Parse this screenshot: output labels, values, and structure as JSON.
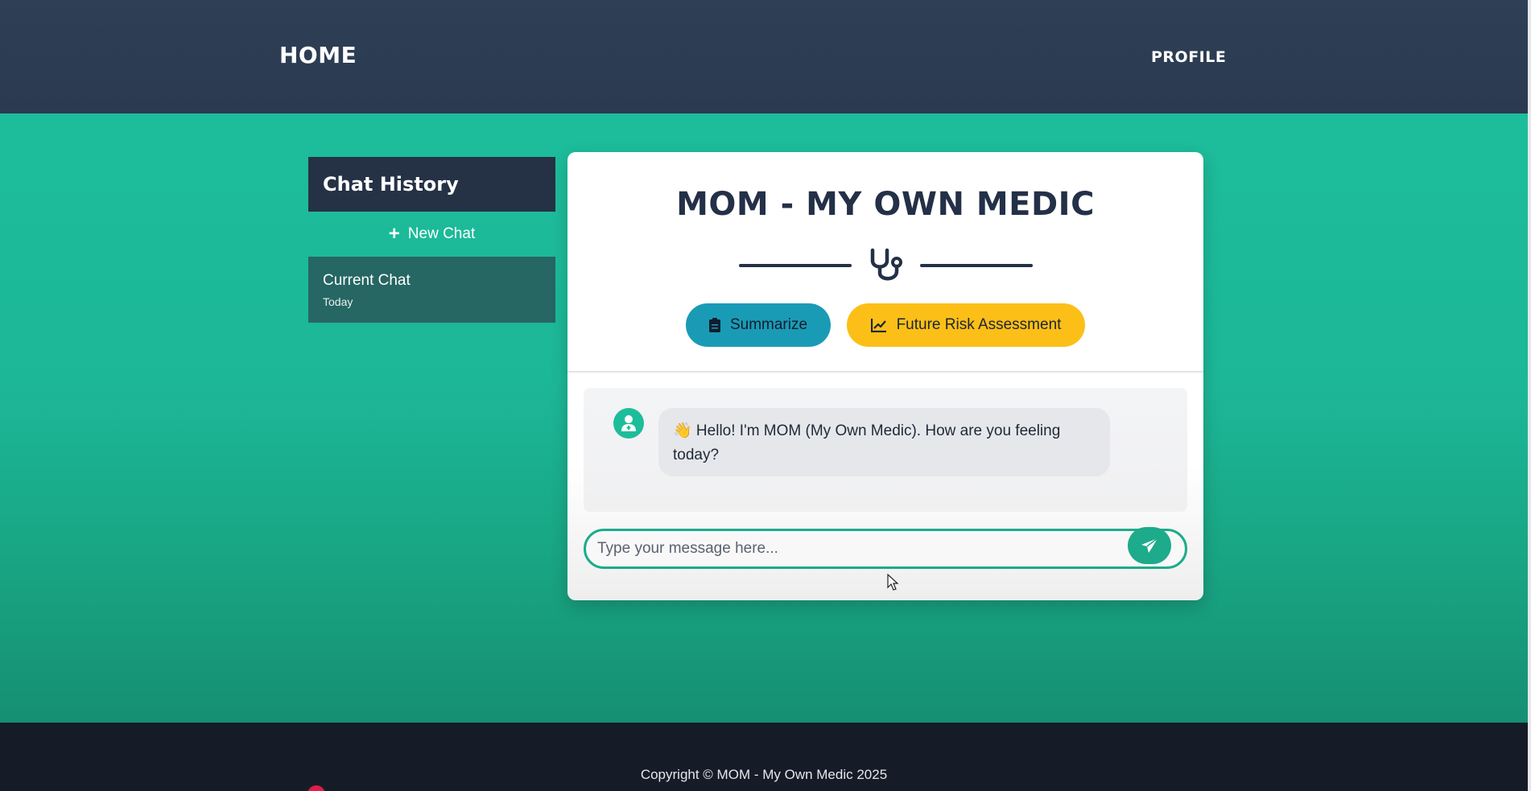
{
  "nav": {
    "home": "HOME",
    "profile": "PROFILE"
  },
  "sidebar": {
    "title": "Chat History",
    "new_chat_label": "New Chat",
    "chats": [
      {
        "title": "Current Chat",
        "date": "Today"
      }
    ]
  },
  "chat": {
    "title": "MOM - MY OWN MEDIC",
    "buttons": {
      "summarize": "Summarize",
      "risk": "Future Risk Assessment"
    },
    "messages": [
      {
        "sender": "bot",
        "text": "👋 Hello! I'm MOM (My Own Medic). How are you feeling today?"
      }
    ],
    "input_placeholder": "Type your message here...",
    "input_value": ""
  },
  "footer": {
    "copyright": "Copyright © MOM - My Own Medic 2025"
  },
  "colors": {
    "header": "#2b3a50",
    "background": "#1dbd9b",
    "sidebar_header": "#253246",
    "active_chat": "#266663",
    "summarize": "#1a9bb5",
    "risk": "#fbbf17",
    "accent": "#1dab8b",
    "footer": "#161c27"
  },
  "icons": {
    "plus": "plus-icon",
    "logo": "stethoscope-icon",
    "summarize": "clipboard-icon",
    "risk": "chart-line-icon",
    "avatar": "doctor-icon",
    "send": "paper-plane-icon"
  }
}
